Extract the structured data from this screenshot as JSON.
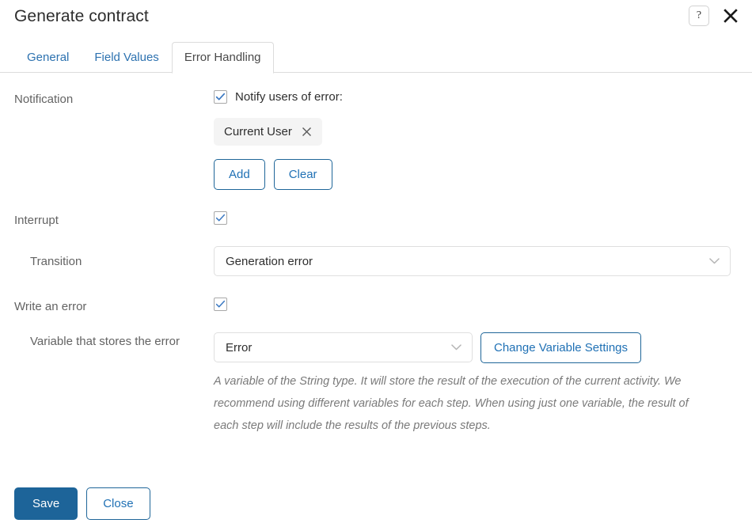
{
  "header": {
    "title": "Generate contract",
    "help_icon": "question-mark-icon",
    "close_icon": "close-icon"
  },
  "tabs": [
    {
      "label": "General",
      "active": false
    },
    {
      "label": "Field Values",
      "active": false
    },
    {
      "label": "Error Handling",
      "active": true
    }
  ],
  "form": {
    "notification": {
      "label": "Notification",
      "checkbox_checked": true,
      "checkbox_caption": "Notify users of error:",
      "chips": [
        {
          "label": "Current User",
          "remove_icon": "close-icon"
        }
      ],
      "add_label": "Add",
      "clear_label": "Clear"
    },
    "interrupt": {
      "label": "Interrupt",
      "checkbox_checked": true
    },
    "transition": {
      "label": "Transition",
      "value": "Generation error",
      "chevron_icon": "chevron-down-icon"
    },
    "write_error": {
      "label": "Write an error",
      "checkbox_checked": true
    },
    "variable": {
      "label": "Variable that stores the error",
      "value": "Error",
      "chevron_icon": "chevron-down-icon",
      "change_settings_label": "Change Variable Settings",
      "hint": "A variable of the String type. It will store the result of the execution of the current activity. We recommend using different variables for each step. When using just one variable, the result of each step will include the results of the previous steps."
    }
  },
  "footer": {
    "save_label": "Save",
    "close_label": "Close"
  },
  "colors": {
    "accent_blue": "#2071b5",
    "primary_button": "#1d6499",
    "border": "#dcdcdc",
    "label_text": "#636363",
    "hint_text": "#7a7a7a",
    "chip_background": "#f4f4f4"
  }
}
